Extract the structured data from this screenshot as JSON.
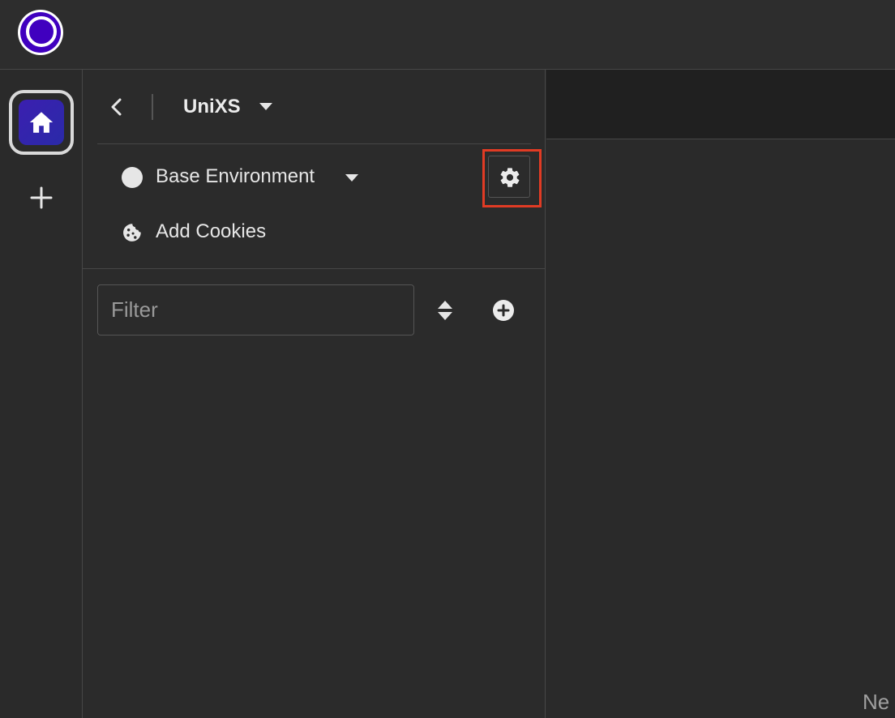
{
  "app": {
    "logo_icon": "app-logo-eye-icon",
    "accent": "#4000bf"
  },
  "rail": {
    "home_icon": "home-icon",
    "add_icon": "plus-icon"
  },
  "workspace": {
    "name": "UniXS",
    "back_icon": "chevron-left-icon",
    "dropdown_icon": "caret-down-icon"
  },
  "environment": {
    "label": "Base Environment",
    "indicator_color": "#e6e6e6",
    "settings_icon": "gear-icon",
    "highlight_color": "#e13b24"
  },
  "cookies": {
    "label": "Add Cookies",
    "icon": "cookie-icon"
  },
  "filter": {
    "placeholder": "Filter",
    "sort_icon": "sort-icon",
    "add_icon": "plus-circle-icon"
  },
  "main": {
    "partial_text": "Ne"
  }
}
